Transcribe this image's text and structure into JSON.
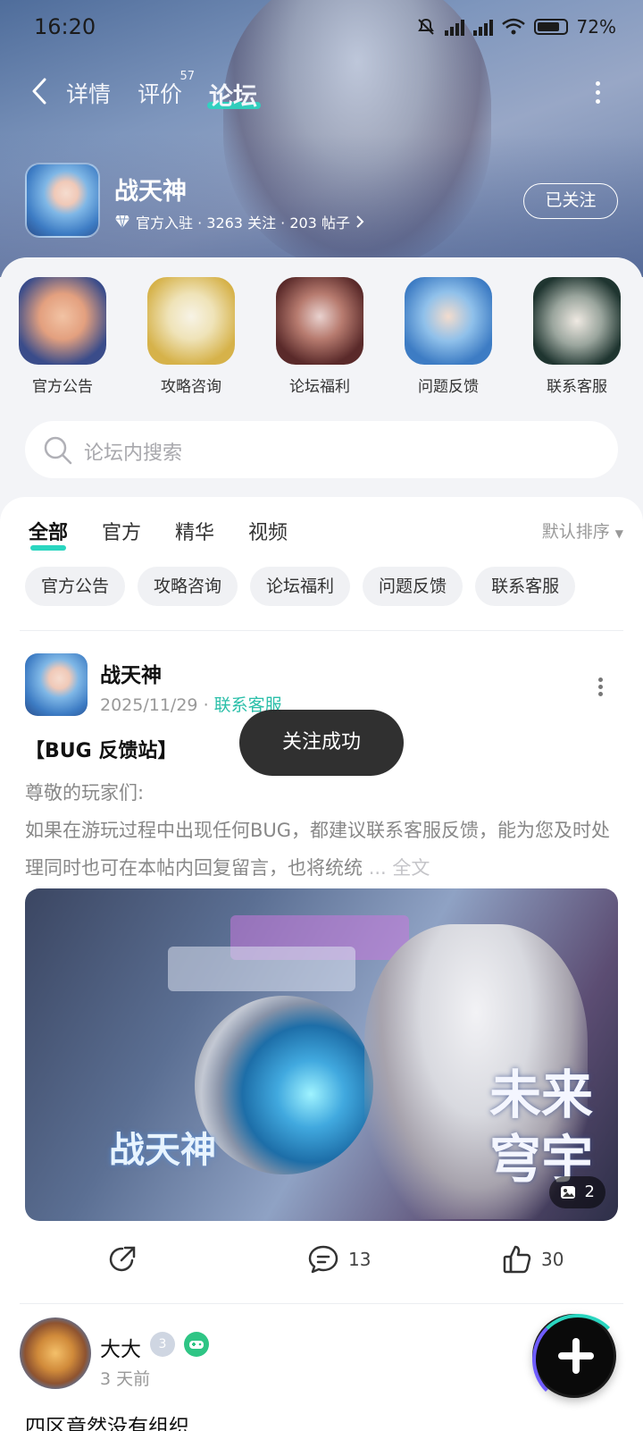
{
  "status_bar": {
    "time": "16:20",
    "battery": "72"
  },
  "nav": {
    "tabs": [
      {
        "label": "详情"
      },
      {
        "label": "评价",
        "badge": "57"
      },
      {
        "label": "论坛"
      }
    ],
    "active_tab": "论坛"
  },
  "game": {
    "name": "战天神",
    "meta": "官方入驻 · 3263 关注 · 203 帖子",
    "follow_label": "已关注"
  },
  "quick_entries": [
    {
      "label": "官方公告",
      "colors": [
        "#f2c3a4",
        "#3a4c8a"
      ]
    },
    {
      "label": "攻略咨询",
      "colors": [
        "#f1ecda",
        "#d6b24a"
      ]
    },
    {
      "label": "论坛福利",
      "colors": [
        "#e1c7c4",
        "#5a2a2a"
      ]
    },
    {
      "label": "问题反馈",
      "colors": [
        "#f3dccd",
        "#3d7cc4"
      ]
    },
    {
      "label": "联系客服",
      "colors": [
        "#e7e3de",
        "#1f3530"
      ]
    }
  ],
  "search": {
    "placeholder": "论坛内搜索"
  },
  "feed_tabs": [
    "全部",
    "官方",
    "精华",
    "视频"
  ],
  "sort_label": "默认排序",
  "chips": [
    "官方公告",
    "攻略咨询",
    "论坛福利",
    "问题反馈",
    "联系客服"
  ],
  "post": {
    "author": "战天神",
    "date": "2025/11/29",
    "tag": "联系客服",
    "title": "【BUG 反馈站】",
    "body_line1": "尊敬的玩家们:",
    "body_line2": " 如果在游玩过程中出现任何BUG，都建议联系客服反馈，能为您及时处理同时也可在本帖内回复留言，也将统统",
    "more": "... 全文",
    "image_count": "2",
    "image_text_main": "未来穹宇",
    "image_text_game": "战天神",
    "comments": "13",
    "likes": "30"
  },
  "toast": "关注成功",
  "post2": {
    "author": "大大",
    "level": "3",
    "time": "3 天前",
    "title": "四区竟然没有组织"
  },
  "colors": {
    "accent": "#2ad6c0",
    "tag": "#2bbfa9"
  }
}
